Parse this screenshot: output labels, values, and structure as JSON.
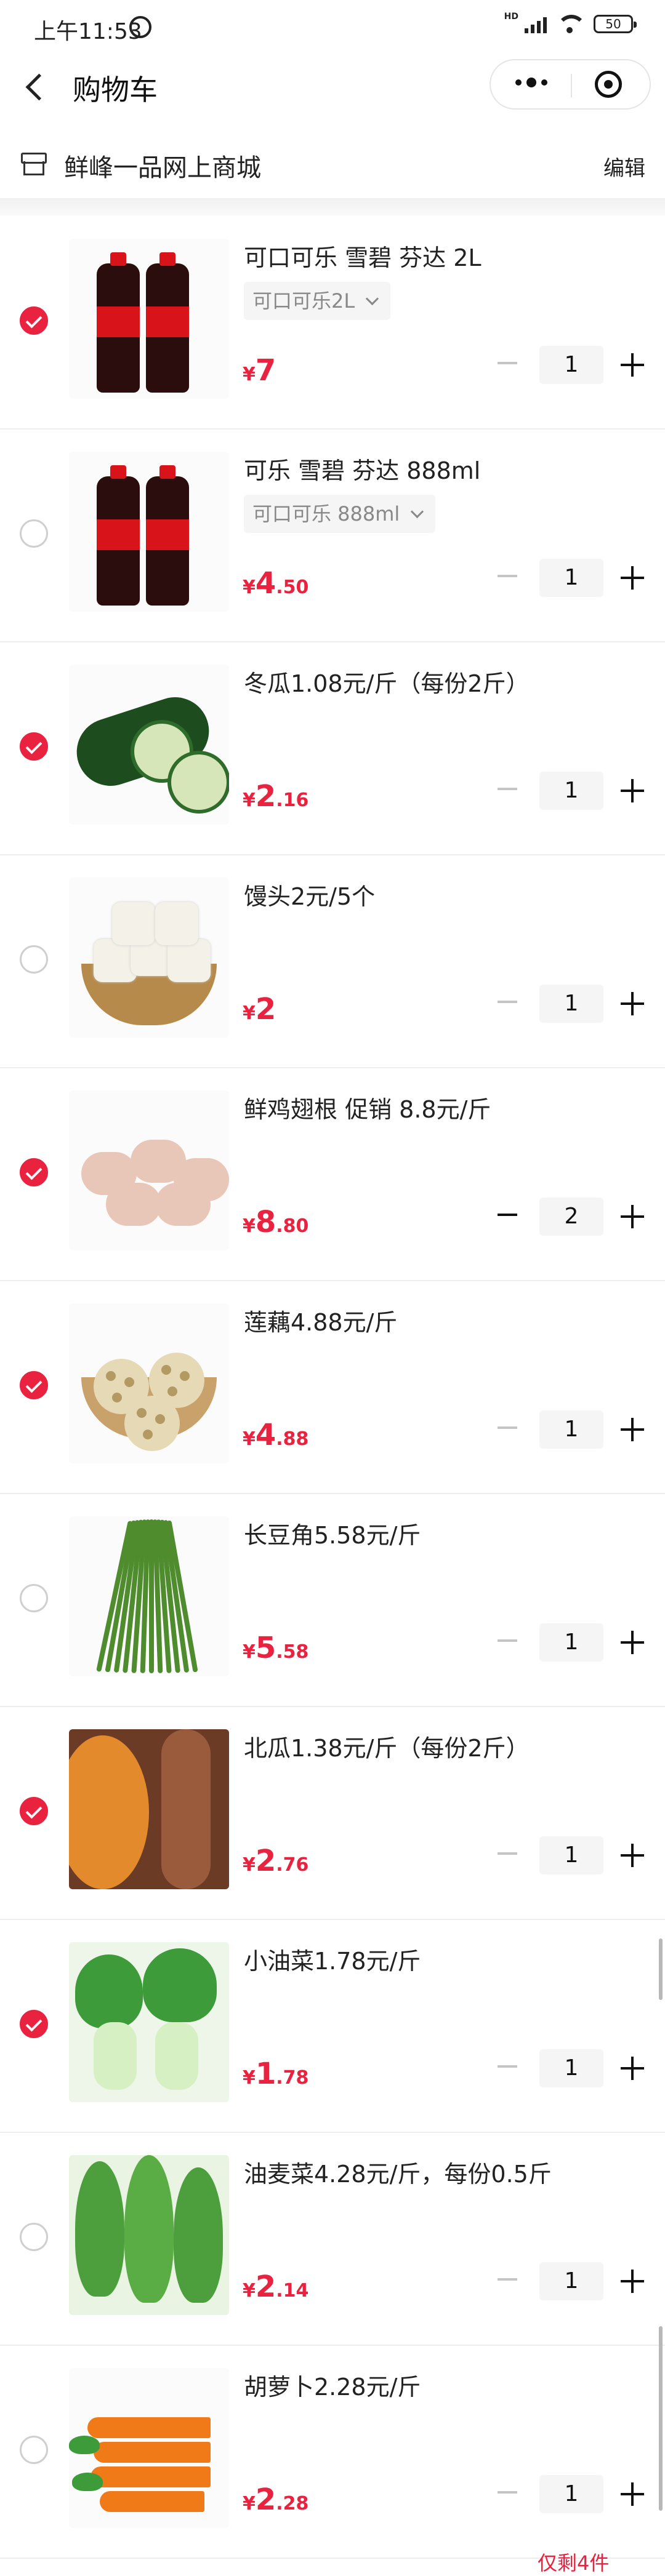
{
  "status_bar": {
    "time": "上午11:53",
    "network": "HD",
    "battery": "50"
  },
  "nav": {
    "title": "购物车"
  },
  "shop": {
    "name": "鲜峰一品网上商城",
    "edit": "编辑"
  },
  "currency": "¥",
  "items": [
    {
      "name": "可口可乐 雪碧 芬达 2L",
      "spec": "可口可乐2L",
      "price_int": "7",
      "price_dec": "",
      "qty": "1",
      "checked": true,
      "minus_active": false,
      "image": "cola-bottles-image"
    },
    {
      "name": "可乐 雪碧 芬达 888ml",
      "spec": "可口可乐 888ml",
      "price_int": "4",
      "price_dec": ".50",
      "qty": "1",
      "checked": false,
      "minus_active": false,
      "image": "cola-bottles-image"
    },
    {
      "name": "冬瓜1.08元/斤（每份2斤）",
      "spec": "",
      "price_int": "2",
      "price_dec": ".16",
      "qty": "1",
      "checked": true,
      "minus_active": false,
      "image": "winter-melon-image"
    },
    {
      "name": "馒头2元/5个",
      "spec": "",
      "price_int": "2",
      "price_dec": "",
      "qty": "1",
      "checked": false,
      "minus_active": false,
      "image": "steamed-buns-image"
    },
    {
      "name": "鲜鸡翅根 促销 8.8元/斤",
      "spec": "",
      "price_int": "8",
      "price_dec": ".80",
      "qty": "2",
      "checked": true,
      "minus_active": true,
      "image": "chicken-drumettes-image"
    },
    {
      "name": "莲藕4.88元/斤",
      "spec": "",
      "price_int": "4",
      "price_dec": ".88",
      "qty": "1",
      "checked": true,
      "minus_active": false,
      "image": "lotus-root-image"
    },
    {
      "name": "长豆角5.58元/斤",
      "spec": "",
      "price_int": "5",
      "price_dec": ".58",
      "qty": "1",
      "checked": false,
      "minus_active": false,
      "image": "long-beans-image"
    },
    {
      "name": "北瓜1.38元/斤（每份2斤）",
      "spec": "",
      "price_int": "2",
      "price_dec": ".76",
      "qty": "1",
      "checked": true,
      "minus_active": false,
      "image": "pumpkin-image"
    },
    {
      "name": "小油菜1.78元/斤",
      "spec": "",
      "price_int": "1",
      "price_dec": ".78",
      "qty": "1",
      "checked": true,
      "minus_active": false,
      "image": "bok-choy-image"
    },
    {
      "name": "油麦菜4.28元/斤，每份0.5斤",
      "spec": "",
      "price_int": "2",
      "price_dec": ".14",
      "qty": "1",
      "checked": false,
      "minus_active": false,
      "image": "lettuce-image"
    },
    {
      "name": "胡萝卜2.28元/斤",
      "spec": "",
      "price_int": "2",
      "price_dec": ".28",
      "qty": "1",
      "checked": false,
      "minus_active": false,
      "image": "carrots-image"
    }
  ],
  "stock_note": "仅剩4件",
  "colors": {
    "accent": "#e8223f",
    "spec_bg": "#f5f5f5",
    "divider": "#eeeeee"
  }
}
